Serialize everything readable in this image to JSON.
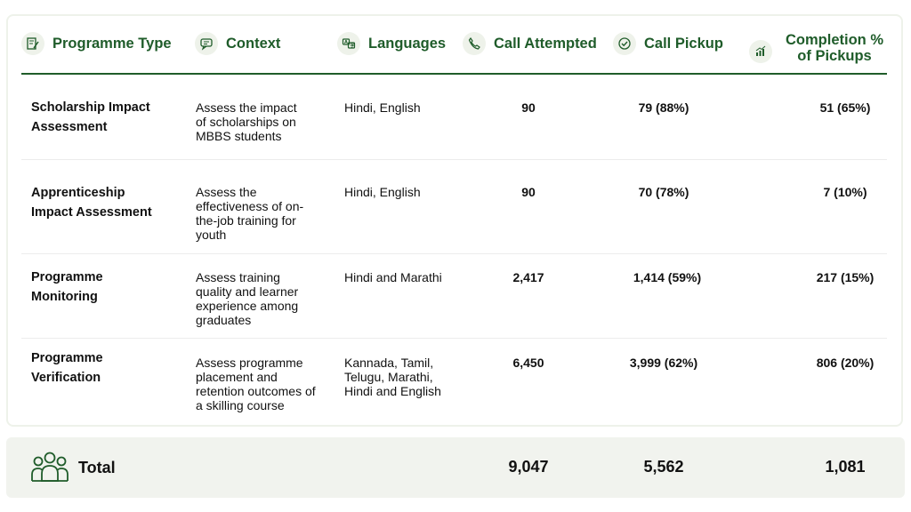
{
  "headers": {
    "programme_type": "Programme Type",
    "context": "Context",
    "languages": "Languages",
    "call_attempted": "Call Attempted",
    "call_pickup": "Call Pickup",
    "completion_line1": "Completion %",
    "completion_line2": "of Pickups"
  },
  "rows": [
    {
      "type_lines": [
        "Scholarship Impact",
        "Assessment"
      ],
      "context_lines": [
        "Assess the impact",
        "of scholarships on",
        "MBBS students"
      ],
      "language_lines": [
        "Hindi, English"
      ],
      "attempted": "90",
      "pickup": "79 (88%)",
      "completion": "51 (65%)"
    },
    {
      "type_lines": [
        "Apprenticeship",
        "Impact Assessment"
      ],
      "context_lines": [
        "Assess the",
        "effectiveness of on-",
        "the-job training for",
        "youth"
      ],
      "language_lines": [
        "Hindi, English"
      ],
      "attempted": "90",
      "pickup": "70 (78%)",
      "completion": "7 (10%)"
    },
    {
      "type_lines": [
        "Programme",
        "Monitoring"
      ],
      "context_lines": [
        "Assess training",
        "quality and learner",
        "experience among",
        "graduates"
      ],
      "language_lines": [
        "Hindi and Marathi"
      ],
      "attempted": "2,417",
      "pickup": "1,414 (59%)",
      "completion": "217 (15%)"
    },
    {
      "type_lines": [
        "Programme",
        "Verification"
      ],
      "context_lines": [
        "Assess programme",
        "placement and",
        "retention outcomes of",
        "a skilling course"
      ],
      "language_lines": [
        "Kannada, Tamil,",
        "Telugu, Marathi,",
        "Hindi and English"
      ],
      "attempted": "6,450",
      "pickup": "3,999 (62%)",
      "completion": "806 (20%)"
    }
  ],
  "total": {
    "label": "Total",
    "attempted": "9,047",
    "pickup": "5,562",
    "completion": "1,081"
  },
  "colors": {
    "accent": "#1f5c2a",
    "icon_bg": "#eef2ea",
    "total_bg": "#f1f3ee"
  },
  "icons": [
    "document-pen-icon",
    "chat-bubble-icon",
    "translate-icon",
    "phone-icon",
    "check-circle-icon",
    "bar-chart-icon",
    "people-group-icon"
  ]
}
